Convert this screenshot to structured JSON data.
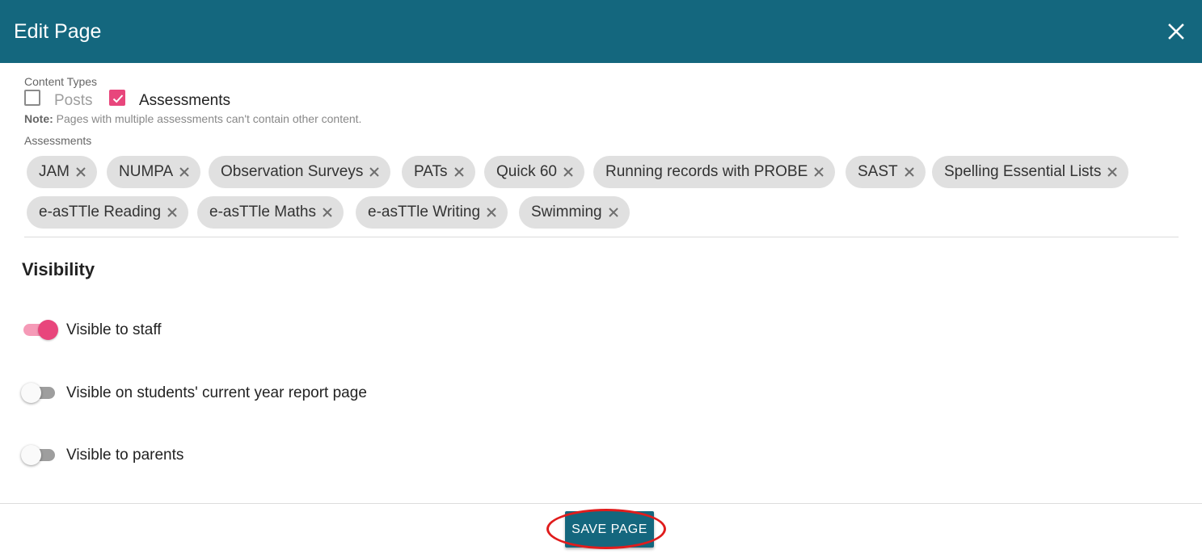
{
  "dialog": {
    "title": "Edit Page",
    "close_icon": "close-icon"
  },
  "content_types": {
    "label": "Content Types",
    "options": [
      {
        "label": "Posts",
        "checked": false
      },
      {
        "label": "Assessments",
        "checked": true
      }
    ],
    "note_prefix": "Note:",
    "note_text": " Pages with multiple assessments can't contain other content."
  },
  "assessments": {
    "label": "Assessments",
    "chips": [
      "JAM",
      "NUMPA",
      "Observation Surveys",
      "PATs",
      "Quick 60",
      "Running records with PROBE",
      "SAST",
      "Spelling Essential Lists",
      "e-asTTle Reading",
      "e-asTTle Maths",
      "e-asTTle Writing",
      "Swimming"
    ]
  },
  "visibility": {
    "heading": "Visibility",
    "toggles": [
      {
        "label": "Visible to staff",
        "on": true
      },
      {
        "label": "Visible on students' current year report page",
        "on": false
      },
      {
        "label": "Visible to parents",
        "on": false
      }
    ]
  },
  "footer": {
    "save_label": "SAVE PAGE"
  },
  "colors": {
    "header": "#14677e",
    "accent": "#e8467c",
    "annotation": "#e01c1c"
  }
}
